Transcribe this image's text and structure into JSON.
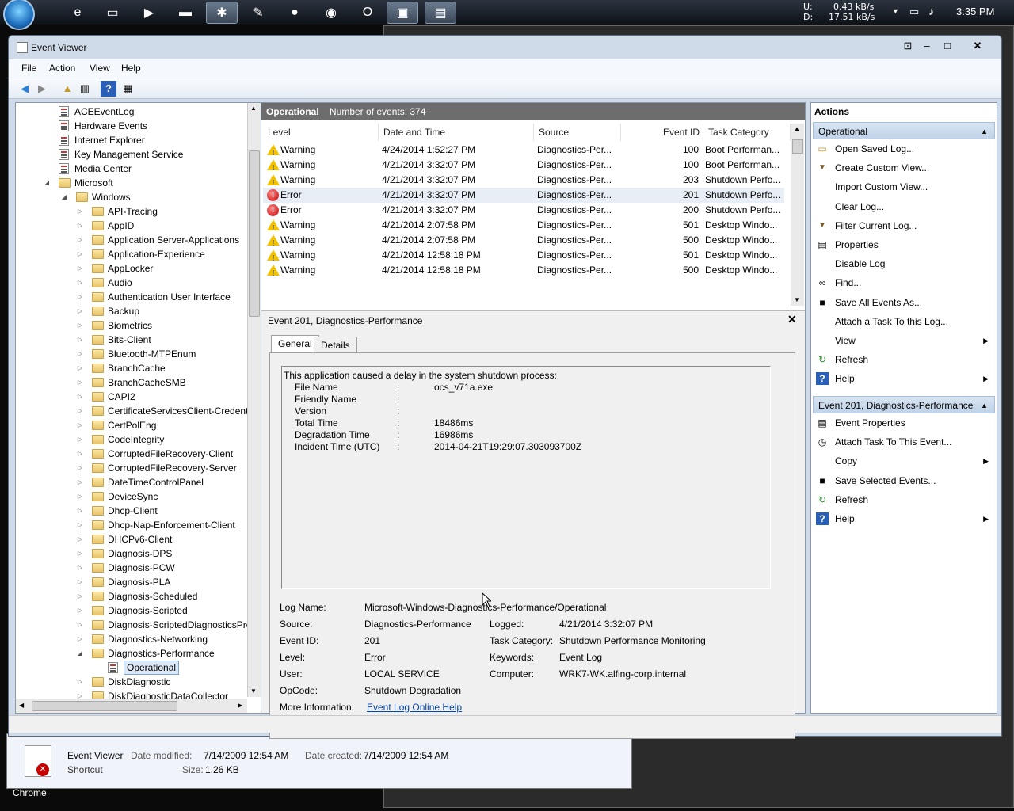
{
  "taskbar": {
    "net_up_label": "U:",
    "net_up": "0.43 kB/s",
    "net_down_label": "D:",
    "net_down": "17.51 kB/s",
    "clock": "3:35 PM"
  },
  "window": {
    "title": "Event Viewer",
    "menu": [
      "File",
      "Action",
      "View",
      "Help"
    ]
  },
  "tree": {
    "items": [
      {
        "label": "ACEEventLog",
        "type": "log"
      },
      {
        "label": "Hardware Events",
        "type": "log"
      },
      {
        "label": "Internet Explorer",
        "type": "log"
      },
      {
        "label": "Key Management Service",
        "type": "log"
      },
      {
        "label": "Media Center",
        "type": "log"
      },
      {
        "label": "Microsoft",
        "type": "folder"
      },
      {
        "label": "Windows",
        "type": "folder"
      },
      {
        "label": "API-Tracing",
        "type": "folder"
      },
      {
        "label": "AppID",
        "type": "folder"
      },
      {
        "label": "Application Server-Applications",
        "type": "folder"
      },
      {
        "label": "Application-Experience",
        "type": "folder"
      },
      {
        "label": "AppLocker",
        "type": "folder"
      },
      {
        "label": "Audio",
        "type": "folder"
      },
      {
        "label": "Authentication User Interface",
        "type": "folder"
      },
      {
        "label": "Backup",
        "type": "folder"
      },
      {
        "label": "Biometrics",
        "type": "folder"
      },
      {
        "label": "Bits-Client",
        "type": "folder"
      },
      {
        "label": "Bluetooth-MTPEnum",
        "type": "folder"
      },
      {
        "label": "BranchCache",
        "type": "folder"
      },
      {
        "label": "BranchCacheSMB",
        "type": "folder"
      },
      {
        "label": "CAPI2",
        "type": "folder"
      },
      {
        "label": "CertificateServicesClient-Credentia",
        "type": "folder"
      },
      {
        "label": "CertPolEng",
        "type": "folder"
      },
      {
        "label": "CodeIntegrity",
        "type": "folder"
      },
      {
        "label": "CorruptedFileRecovery-Client",
        "type": "folder"
      },
      {
        "label": "CorruptedFileRecovery-Server",
        "type": "folder"
      },
      {
        "label": "DateTimeControlPanel",
        "type": "folder"
      },
      {
        "label": "DeviceSync",
        "type": "folder"
      },
      {
        "label": "Dhcp-Client",
        "type": "folder"
      },
      {
        "label": "Dhcp-Nap-Enforcement-Client",
        "type": "folder"
      },
      {
        "label": "DHCPv6-Client",
        "type": "folder"
      },
      {
        "label": "Diagnosis-DPS",
        "type": "folder"
      },
      {
        "label": "Diagnosis-PCW",
        "type": "folder"
      },
      {
        "label": "Diagnosis-PLA",
        "type": "folder"
      },
      {
        "label": "Diagnosis-Scheduled",
        "type": "folder"
      },
      {
        "label": "Diagnosis-Scripted",
        "type": "folder"
      },
      {
        "label": "Diagnosis-ScriptedDiagnosticsProv",
        "type": "folder"
      },
      {
        "label": "Diagnostics-Networking",
        "type": "folder"
      },
      {
        "label": "Diagnostics-Performance",
        "type": "folder"
      },
      {
        "label": "Operational",
        "type": "log"
      },
      {
        "label": "DiskDiagnostic",
        "type": "folder"
      },
      {
        "label": "DiskDiagnosticDataCollector",
        "type": "folder"
      }
    ]
  },
  "events": {
    "header_title": "Operational",
    "header_count": "Number of events: 374",
    "columns": [
      "Level",
      "Date and Time",
      "Source",
      "Event ID",
      "Task Category"
    ],
    "rows": [
      {
        "level": "Warning",
        "date": "4/24/2014 1:52:27 PM",
        "source": "Diagnostics-Per...",
        "id": "100",
        "task": "Boot Performan..."
      },
      {
        "level": "Warning",
        "date": "4/21/2014 3:32:07 PM",
        "source": "Diagnostics-Per...",
        "id": "100",
        "task": "Boot Performan..."
      },
      {
        "level": "Warning",
        "date": "4/21/2014 3:32:07 PM",
        "source": "Diagnostics-Per...",
        "id": "203",
        "task": "Shutdown Perfo..."
      },
      {
        "level": "Error",
        "date": "4/21/2014 3:32:07 PM",
        "source": "Diagnostics-Per...",
        "id": "201",
        "task": "Shutdown Perfo..."
      },
      {
        "level": "Error",
        "date": "4/21/2014 3:32:07 PM",
        "source": "Diagnostics-Per...",
        "id": "200",
        "task": "Shutdown Perfo..."
      },
      {
        "level": "Warning",
        "date": "4/21/2014 2:07:58 PM",
        "source": "Diagnostics-Per...",
        "id": "501",
        "task": "Desktop Windo..."
      },
      {
        "level": "Warning",
        "date": "4/21/2014 2:07:58 PM",
        "source": "Diagnostics-Per...",
        "id": "500",
        "task": "Desktop Windo..."
      },
      {
        "level": "Warning",
        "date": "4/21/2014 12:58:18 PM",
        "source": "Diagnostics-Per...",
        "id": "501",
        "task": "Desktop Windo..."
      },
      {
        "level": "Warning",
        "date": "4/21/2014 12:58:18 PM",
        "source": "Diagnostics-Per...",
        "id": "500",
        "task": "Desktop Windo..."
      }
    ]
  },
  "detail": {
    "title": "Event 201, Diagnostics-Performance",
    "tabs": [
      "General",
      "Details"
    ],
    "message": "This application caused a delay in the system shutdown process:",
    "fields": [
      {
        "k": "File Name",
        "v": "ocs_v71a.exe"
      },
      {
        "k": "Friendly Name",
        "v": ""
      },
      {
        "k": "Version",
        "v": ""
      },
      {
        "k": "Total Time",
        "v": "18486ms"
      },
      {
        "k": "Degradation Time",
        "v": "16986ms"
      },
      {
        "k": "Incident Time (UTC)",
        "v": "2014-04-21T19:29:07.303093700Z"
      }
    ],
    "sep": ":",
    "log_name_k": "Log Name:",
    "log_name_v": "Microsoft-Windows-Diagnostics-Performance/Operational",
    "source_k": "Source:",
    "source_v": "Diagnostics-Performance",
    "logged_k": "Logged:",
    "logged_v": "4/21/2014 3:32:07 PM",
    "eventid_k": "Event ID:",
    "eventid_v": "201",
    "taskcat_k": "Task Category:",
    "taskcat_v": "Shutdown Performance Monitoring",
    "level_k": "Level:",
    "level_v": "Error",
    "keywords_k": "Keywords:",
    "keywords_v": "Event Log",
    "user_k": "User:",
    "user_v": "LOCAL SERVICE",
    "computer_k": "Computer:",
    "computer_v": "WRK7-WK.alfing-corp.internal",
    "opcode_k": "OpCode:",
    "opcode_v": "Shutdown Degradation",
    "moreinfo_k": "More Information:",
    "moreinfo_v": "Event Log Online Help"
  },
  "actions": {
    "header": "Actions",
    "section1": "Operational",
    "items1": [
      {
        "label": "Open Saved Log...",
        "icon": "folder-icon",
        "sub": false
      },
      {
        "label": "Create Custom View...",
        "icon": "filter-icon",
        "sub": false
      },
      {
        "label": "Import Custom View...",
        "icon": "",
        "sub": false
      },
      {
        "label": "Clear Log...",
        "icon": "",
        "sub": false
      },
      {
        "label": "Filter Current Log...",
        "icon": "filter-icon",
        "sub": false
      },
      {
        "label": "Properties",
        "icon": "properties-icon",
        "sub": false
      },
      {
        "label": "Disable Log",
        "icon": "",
        "sub": false
      },
      {
        "label": "Find...",
        "icon": "binoculars-icon",
        "sub": false
      },
      {
        "label": "Save All Events As...",
        "icon": "save-icon",
        "sub": false
      },
      {
        "label": "Attach a Task To this Log...",
        "icon": "",
        "sub": false
      },
      {
        "label": "View",
        "icon": "",
        "sub": true
      },
      {
        "label": "Refresh",
        "icon": "refresh-icon",
        "sub": false
      },
      {
        "label": "Help",
        "icon": "help-icon",
        "sub": true
      }
    ],
    "section2": "Event 201, Diagnostics-Performance",
    "items2": [
      {
        "label": "Event Properties",
        "icon": "properties-icon",
        "sub": false
      },
      {
        "label": "Attach Task To This Event...",
        "icon": "task-icon",
        "sub": false
      },
      {
        "label": "Copy",
        "icon": "",
        "sub": true
      },
      {
        "label": "Save Selected Events...",
        "icon": "save-icon",
        "sub": false
      },
      {
        "label": "Refresh",
        "icon": "refresh-icon",
        "sub": false
      },
      {
        "label": "Help",
        "icon": "help-icon",
        "sub": true
      }
    ]
  },
  "explorer": {
    "name": "Event Viewer",
    "type": "Shortcut",
    "modified_k": "Date modified:",
    "modified_v": "7/14/2009 12:54 AM",
    "created_k": "Date created:",
    "created_v": "7/14/2009 12:54 AM",
    "size_k": "Size:",
    "size_v": "1.26 KB",
    "chrome_label": "Chrome"
  }
}
